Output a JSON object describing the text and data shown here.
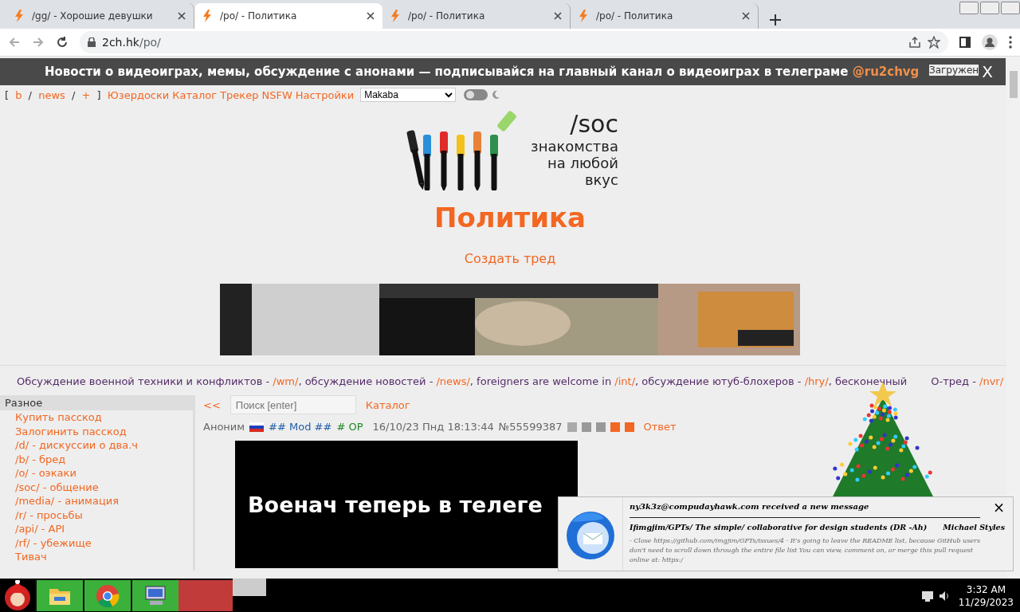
{
  "tabs": [
    {
      "title": "/gg/ - Хорошие девушки",
      "selected": false
    },
    {
      "title": "/po/ - Политика",
      "selected": true
    },
    {
      "title": "/po/ - Политика",
      "selected": false
    },
    {
      "title": "/po/ - Политика",
      "selected": false
    }
  ],
  "address_bar": {
    "host": "2ch.hk",
    "path": "/po/"
  },
  "announcement": {
    "text": "Новости о видеоиграх, мемы, обсуждение с анонами — подписывайся на главный канал о видеоиграх в телеграме ",
    "link": "@ru2chvg",
    "close": "X",
    "behind_right": "Загружен"
  },
  "nav": {
    "links": [
      {
        "text": "[ ",
        "kind": "plain"
      },
      {
        "text": "b",
        "kind": "link"
      },
      {
        "text": " / ",
        "kind": "plain"
      },
      {
        "text": "news",
        "kind": "link"
      },
      {
        "text": " / ",
        "kind": "plain"
      },
      {
        "text": "+",
        "kind": "link"
      },
      {
        "text": " ] ",
        "kind": "plain"
      },
      {
        "text": "Юзердоски",
        "kind": "link"
      },
      {
        "text": "Каталог",
        "kind": "link"
      },
      {
        "text": "Трекер",
        "kind": "link"
      },
      {
        "text": "NSFW",
        "kind": "link"
      },
      {
        "text": "Настройки",
        "kind": "link"
      }
    ],
    "style_select": "Makaba",
    "dark_mode": {
      "on": false
    }
  },
  "logo": {
    "board": "/soc",
    "tagline": [
      "знакомства",
      "на любой",
      "вкус"
    ]
  },
  "board_title": "Политика",
  "create_thread": "Создать тред",
  "board_links": [
    {
      "text": "Обсуждение военной техники и конфликтов - ",
      "kind": "plain"
    },
    {
      "text": "/wm/",
      "kind": "link"
    },
    {
      "text": ", обсуждение новостей - ",
      "kind": "plain"
    },
    {
      "text": "/news/",
      "kind": "link"
    },
    {
      "text": ", foreigners are welcome in ",
      "kind": "plain"
    },
    {
      "text": "/int/",
      "kind": "link"
    },
    {
      "text": ", обсуждение ютуб-блохеров - ",
      "kind": "plain"
    },
    {
      "text": "/hry/",
      "kind": "link"
    },
    {
      "text": ", бесконечный",
      "kind": "plain"
    },
    {
      "text": "О-тред - ",
      "kind": "plain"
    },
    {
      "text": "/nvr/",
      "kind": "link"
    }
  ],
  "sidebar": {
    "header": "Разное",
    "items": [
      "Купить пасскод",
      "Залогинить пасскод",
      "/d/ - дискуссии о два.ч",
      "/b/ - бред",
      "/o/ - оэкаки",
      "/soc/ - общение",
      "/media/ - анимация",
      "/r/ - просьбы",
      "/api/ - API",
      "/rf/ - убежище",
      "Тивач"
    ]
  },
  "toolbar": {
    "back": "<<",
    "search": {
      "placeholder": "Поиск [enter]"
    },
    "catalog": "Каталог"
  },
  "post": {
    "name": "Аноним",
    "tripcode": "## Mod ##",
    "op": "# OP",
    "date": "16/10/23 Пнд 18:13:44",
    "number": "№55599387",
    "reply": "Ответ",
    "image_text": "Военач теперь в телеге"
  },
  "notification": {
    "title": "ny3k3z@compudayhawk.com received a new message",
    "subject": "Ifimgjim/GPTs/ The simple/ collaborative for design students (DR -Ah)",
    "sender": "Michael Styles",
    "preview": "- Close https://github.com/imgjim/GPTs/issues/4 - It's going to leave the README list, because GitHub users don't need to scroll down through the entire file list You can view, comment on, or merge this pull request online at: https:/",
    "close": "×"
  },
  "taskbar": {
    "time": "3:32 AM",
    "date": "11/29/2023"
  }
}
